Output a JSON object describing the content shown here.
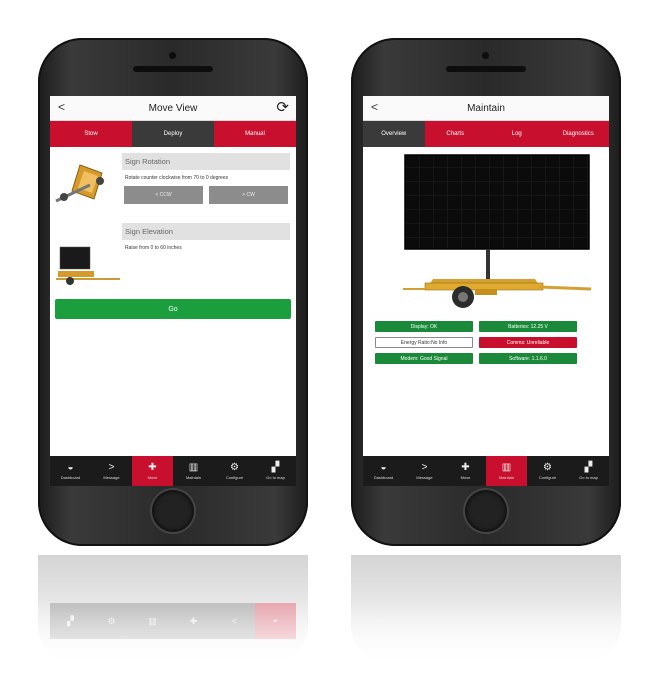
{
  "left_phone": {
    "title": "Move View",
    "tabs": [
      {
        "label": "Stow",
        "active": false
      },
      {
        "label": "Deploy",
        "active": true
      },
      {
        "label": "Manual",
        "active": false
      }
    ],
    "rotation": {
      "title": "Sign Rotation",
      "desc": "Rotate counter clockwise from 70 to 0 degrees",
      "ccw_label": "< CCW",
      "cw_label": "> CW"
    },
    "elevation": {
      "title": "Sign Elevation",
      "desc": "Raise from 0 to 60 inches"
    },
    "go_label": "Go",
    "nav": [
      {
        "label": "Dashboard",
        "icon": "dashboard-icon",
        "glyph": "◒"
      },
      {
        "label": "Message",
        "icon": "chevron-right-icon",
        "glyph": ">"
      },
      {
        "label": "Move",
        "icon": "move-icon",
        "glyph": "✚"
      },
      {
        "label": "Maintain",
        "icon": "bar-chart-icon",
        "glyph": "▥"
      },
      {
        "label": "Configure",
        "icon": "share-icon",
        "glyph": "⚙"
      },
      {
        "label": "Go to map",
        "icon": "map-icon",
        "glyph": "▞"
      }
    ],
    "active_nav": "Move"
  },
  "right_phone": {
    "title": "Maintain",
    "tabs": [
      {
        "label": "Overview",
        "active": true
      },
      {
        "label": "Charts",
        "active": false
      },
      {
        "label": "Log",
        "active": false
      },
      {
        "label": "Diagnostics",
        "active": false
      }
    ],
    "statuses": [
      {
        "label": "Display: OK",
        "color": "green"
      },
      {
        "label": "Batteries: 12.25 V",
        "color": "green"
      },
      {
        "label": "Energy Ratio:No Info",
        "color": "white"
      },
      {
        "label": "Comms: Unreliable",
        "color": "red"
      },
      {
        "label": "Modem: Good Signal",
        "color": "green"
      },
      {
        "label": "Software: 1.1.6.0",
        "color": "green"
      }
    ],
    "nav": [
      {
        "label": "Dashboard",
        "icon": "dashboard-icon",
        "glyph": "◒"
      },
      {
        "label": "Message",
        "icon": "chevron-right-icon",
        "glyph": ">"
      },
      {
        "label": "Move",
        "icon": "move-icon",
        "glyph": "✚"
      },
      {
        "label": "Maintain",
        "icon": "bar-chart-icon",
        "glyph": "▥"
      },
      {
        "label": "Configure",
        "icon": "share-icon",
        "glyph": "⚙"
      },
      {
        "label": "Go to map",
        "icon": "map-icon",
        "glyph": "▞"
      }
    ],
    "active_nav": "Maintain"
  },
  "colors": {
    "brand_red": "#c8102e",
    "go_green": "#1a9e3e",
    "status_green": "#1a8a3a",
    "nav_dark": "#1b1b1b"
  }
}
